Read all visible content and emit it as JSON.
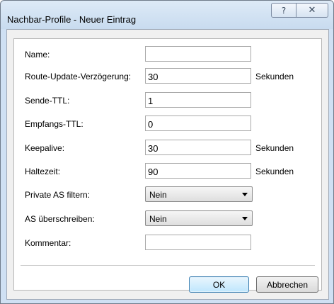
{
  "window": {
    "title": "Nachbar-Profile - Neuer Eintrag",
    "help_icon": "?",
    "close_icon": "✕"
  },
  "form": {
    "name": {
      "label": "Name:",
      "value": ""
    },
    "route_update": {
      "label": "Route-Update-Verzögerung:",
      "value": "30",
      "unit": "Sekunden"
    },
    "send_ttl": {
      "label": "Sende-TTL:",
      "value": "1"
    },
    "recv_ttl": {
      "label": "Empfangs-TTL:",
      "value": "0"
    },
    "keepalive": {
      "label": "Keepalive:",
      "value": "30",
      "unit": "Sekunden"
    },
    "hold_time": {
      "label": "Haltezeit:",
      "value": "90",
      "unit": "Sekunden"
    },
    "private_as_filter": {
      "label": "Private AS filtern:",
      "selected": "Nein"
    },
    "as_override": {
      "label": "AS überschreiben:",
      "selected": "Nein"
    },
    "comment": {
      "label": "Kommentar:",
      "value": ""
    }
  },
  "buttons": {
    "ok_label": "OK",
    "cancel_label": "Abbrechen"
  }
}
